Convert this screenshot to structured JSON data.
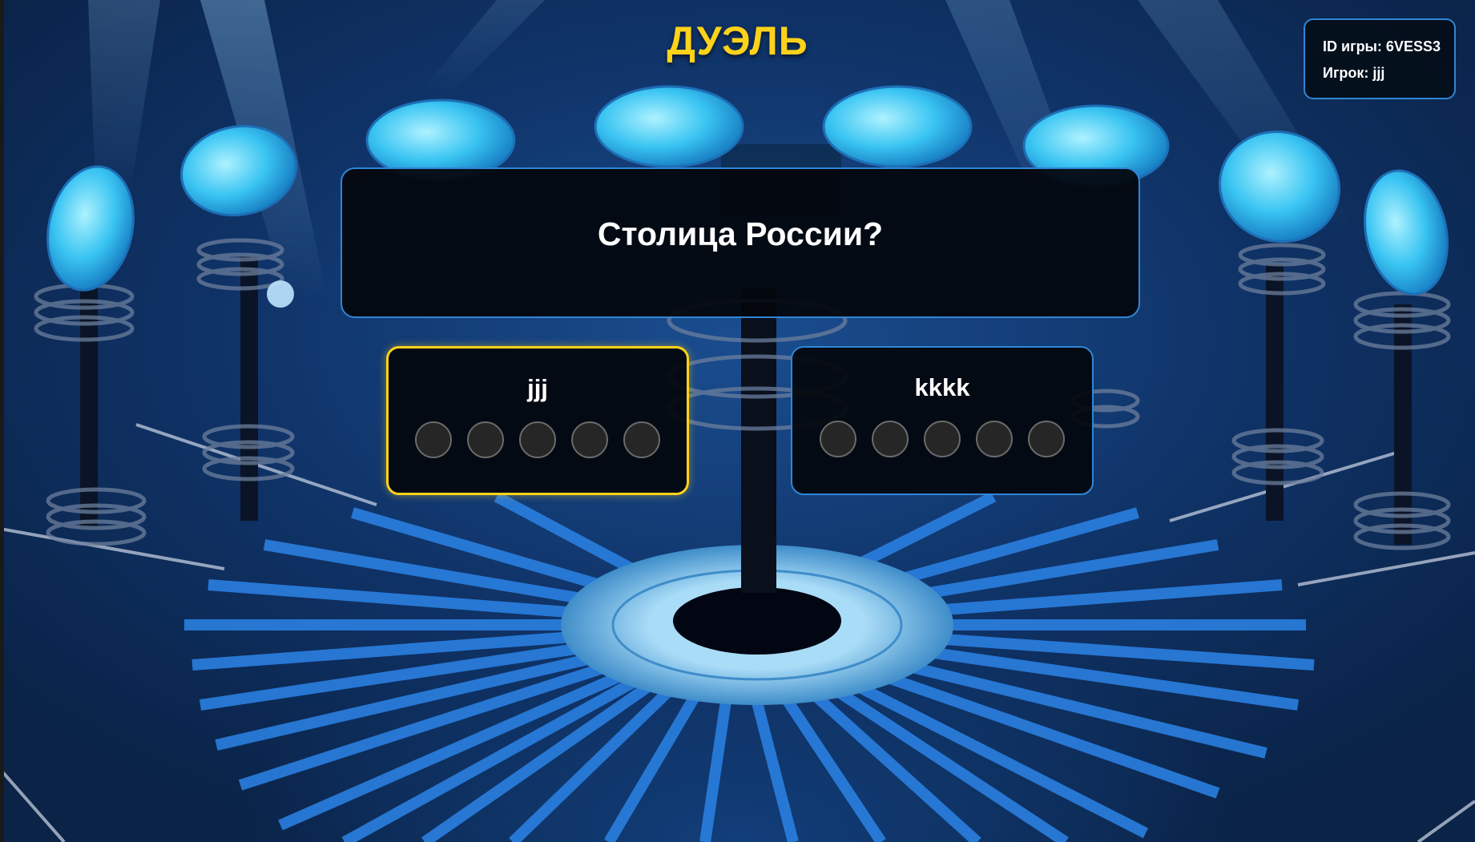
{
  "title": "ДУЭЛЬ",
  "game_info": {
    "game_id_label": "ID игры: 6VESS3",
    "player_label": "Игрок: jjj"
  },
  "question": {
    "text": "Столица России?"
  },
  "players": [
    {
      "name": "jjj",
      "is_current": true,
      "answers": [
        null,
        null,
        null,
        null,
        null
      ]
    },
    {
      "name": "kkkk",
      "is_current": false,
      "answers": [
        null,
        null,
        null,
        null,
        null
      ]
    }
  ],
  "colors": {
    "accent_gold": "#ffd21a",
    "accent_blue": "#2f86d6",
    "card_bg": "#05080f",
    "dot_empty": "#262626"
  }
}
